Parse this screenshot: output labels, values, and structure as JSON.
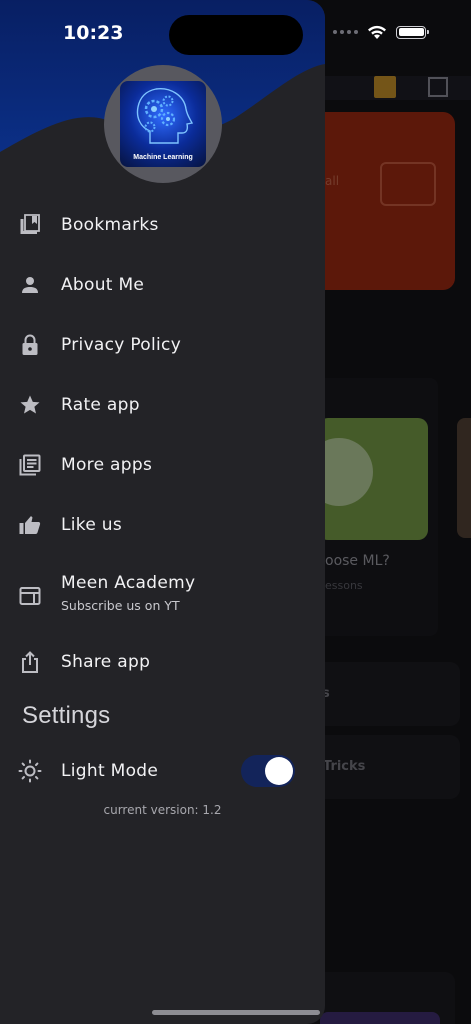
{
  "status_bar": {
    "time": "10:23"
  },
  "drawer": {
    "logo_text": "Machine Learning",
    "menu": [
      {
        "label": "Bookmarks",
        "icon": "bookmarks-icon"
      },
      {
        "label": "About Me",
        "icon": "person-icon"
      },
      {
        "label": "Privacy Policy",
        "icon": "lock-icon"
      },
      {
        "label": "Rate app",
        "icon": "star-icon"
      },
      {
        "label": "More apps",
        "icon": "library-icon"
      },
      {
        "label": "Like us",
        "icon": "thumbs-up-icon"
      },
      {
        "label": "Meen Academy",
        "sublabel": "Subscribe us on YT",
        "icon": "web-icon"
      },
      {
        "label": "Share app",
        "icon": "share-icon"
      }
    ],
    "settings_title": "Settings",
    "light_mode": {
      "label": "Light Mode",
      "icon": "sun-icon",
      "enabled": true
    },
    "version": "current version: 1.2"
  },
  "background": {
    "card_text": "all",
    "why_title": "oose ML?",
    "lessons": "essons",
    "row1": "s",
    "row2": "Tricks"
  },
  "colors": {
    "drawer_bg": "#232327",
    "header_blue": "#0a2a78",
    "toggle_track": "#13245a"
  }
}
